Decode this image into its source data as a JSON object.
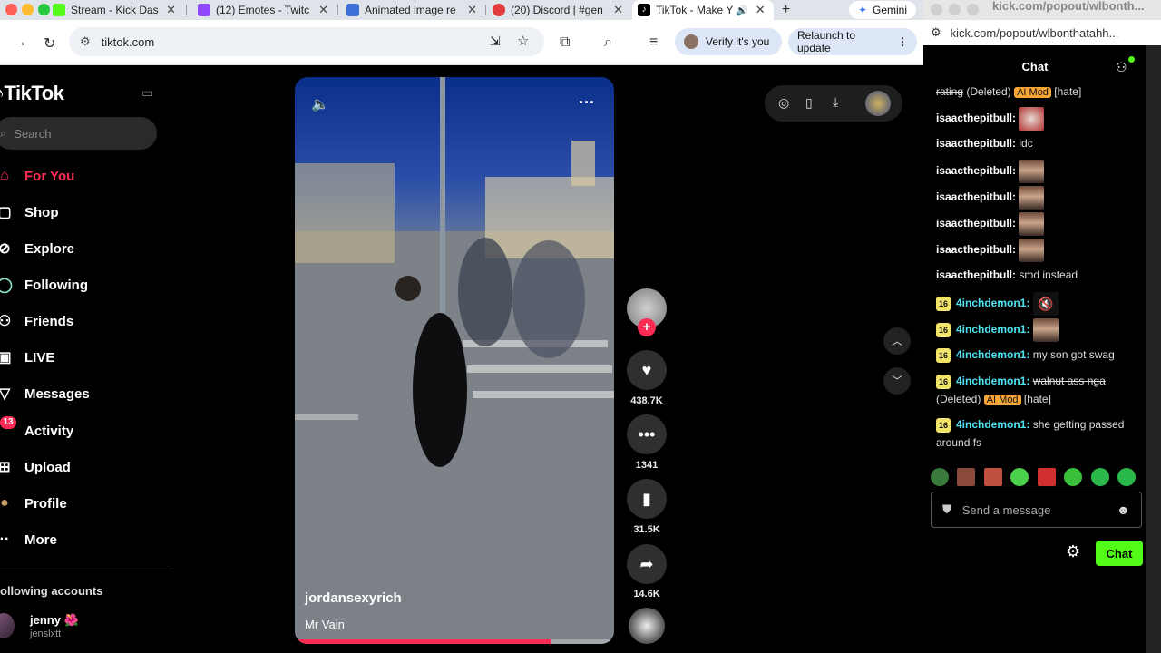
{
  "browser": {
    "tabs": [
      {
        "title": "Stream - Kick Dash",
        "favicon_color": "#53fc18"
      },
      {
        "title": "(12) Emotes - Twitc",
        "favicon_color": "#9146ff"
      },
      {
        "title": "Animated image re",
        "favicon_color": "#3c6fd8"
      },
      {
        "title": "(20) Discord | #gen",
        "favicon_color": "#e23b3b"
      },
      {
        "title": "TikTok - Make Y",
        "favicon_color": "#000000"
      }
    ],
    "new_tab_label": "+",
    "gemini_label": "Gemini",
    "url": "tiktok.com",
    "verify_label": "Verify it's you",
    "relaunch_label": "Relaunch to update"
  },
  "tiktok": {
    "logo": "TikTok",
    "search_placeholder": "Search",
    "nav": [
      {
        "label": "For You",
        "icon": "home-icon",
        "active": true
      },
      {
        "label": "Shop",
        "icon": "shop-icon"
      },
      {
        "label": "Explore",
        "icon": "compass-icon"
      },
      {
        "label": "Following",
        "icon": "following-icon"
      },
      {
        "label": "Friends",
        "icon": "friends-icon"
      },
      {
        "label": "LIVE",
        "icon": "live-icon"
      },
      {
        "label": "Messages",
        "icon": "messages-icon"
      },
      {
        "label": "Activity",
        "icon": "activity-icon"
      },
      {
        "label": "Upload",
        "icon": "upload-icon"
      },
      {
        "label": "Profile",
        "icon": "profile-icon"
      },
      {
        "label": "More",
        "icon": "more-icon"
      }
    ],
    "activity_badge": "13",
    "following_accounts_label": "ollowing accounts",
    "account": {
      "name": "jenny 🌺",
      "handle": "jenslxtt"
    },
    "video": {
      "author": "jordansexyrich",
      "music": "Mr Vain",
      "progress": 0.8
    },
    "actions": {
      "likes": "438.7K",
      "comments": "1341",
      "saves": "31.5K",
      "shares": "14.6K"
    }
  },
  "kick": {
    "window_title": "kick.com/popout/wlbonth...",
    "url": "kick.com/popout/wlbonthatahh...",
    "chat_title": "Chat",
    "messages": [
      {
        "user": "",
        "text": "rating",
        "deleted": "(Deleted)",
        "tag": "AI Mod",
        "reason": "[hate]"
      },
      {
        "user": "isaacthepitbull:",
        "emote": true
      },
      {
        "user": "isaacthepitbull:",
        "text": "idc"
      },
      {
        "user": "isaacthepitbull:",
        "emote": true
      },
      {
        "user": "isaacthepitbull:",
        "emote": true
      },
      {
        "user": "isaacthepitbull:",
        "emote": true
      },
      {
        "user": "isaacthepitbull:",
        "emote": true
      },
      {
        "user": "isaacthepitbull:",
        "text": "smd instead"
      },
      {
        "badge": "16",
        "user": "4inchdemon1:",
        "emote": true
      },
      {
        "badge": "16",
        "user": "4inchdemon1:",
        "emote": true
      },
      {
        "badge": "16",
        "user": "4inchdemon1:",
        "text": "my son got swag"
      },
      {
        "badge": "16",
        "user": "4inchdemon1:",
        "text": "walnut ass nga",
        "deleted": "(Deleted)",
        "tag": "AI Mod",
        "reason": "[hate]"
      },
      {
        "badge": "16",
        "user": "4inchdemon1:",
        "text": "she getting passed around fs"
      }
    ],
    "input_placeholder": "Send a message",
    "send_label": "Chat"
  }
}
